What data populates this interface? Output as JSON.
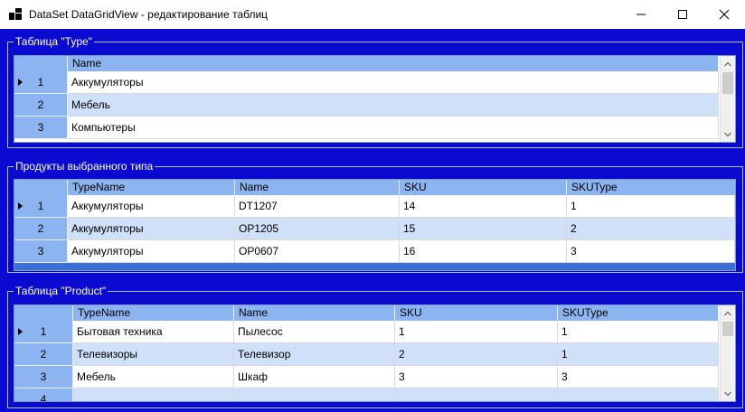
{
  "window": {
    "title": "DataSet DataGridView - редактирование таблиц"
  },
  "groups": {
    "type": {
      "label": "Таблица \"Type\"",
      "columns": [
        "Name"
      ],
      "rows": [
        {
          "num": "1",
          "cells": [
            "Аккумуляторы"
          ],
          "current": true
        },
        {
          "num": "2",
          "cells": [
            "Мебель"
          ],
          "current": false
        },
        {
          "num": "3",
          "cells": [
            "Компьютеры"
          ],
          "current": false
        }
      ]
    },
    "products_selected": {
      "label": "Продукты выбранного типа",
      "columns": [
        "TypeName",
        "Name",
        "SKU",
        "SKUType"
      ],
      "rows": [
        {
          "num": "1",
          "cells": [
            "Аккумуляторы",
            "DT1207",
            "14",
            "1"
          ],
          "current": true
        },
        {
          "num": "2",
          "cells": [
            "Аккумуляторы",
            "OP1205",
            "15",
            "2"
          ],
          "current": false
        },
        {
          "num": "3",
          "cells": [
            "Аккумуляторы",
            "OP0607",
            "16",
            "3"
          ],
          "current": false
        }
      ]
    },
    "product": {
      "label": "Таблица \"Product\"",
      "columns": [
        "TypeName",
        "Name",
        "SKU",
        "SKUType"
      ],
      "rows": [
        {
          "num": "1",
          "cells": [
            "Бытовая техника",
            "Пылесос",
            "1",
            "1"
          ],
          "current": true
        },
        {
          "num": "2",
          "cells": [
            "Телевизоры",
            "Телевизор",
            "2",
            "1"
          ],
          "current": false
        },
        {
          "num": "3",
          "cells": [
            "Мебель",
            "Шкаф",
            "3",
            "3"
          ],
          "current": false
        },
        {
          "num": "4",
          "cells": [
            "",
            "",
            "",
            ""
          ],
          "current": false
        }
      ]
    }
  },
  "colors": {
    "background": "#0a0ad0",
    "header": "#8cb4f0",
    "alt_row": "#cfe0f8"
  },
  "icons": {
    "app": "app-window-icon",
    "minimize": "minimize-icon",
    "maximize": "maximize-icon",
    "close": "close-icon"
  }
}
